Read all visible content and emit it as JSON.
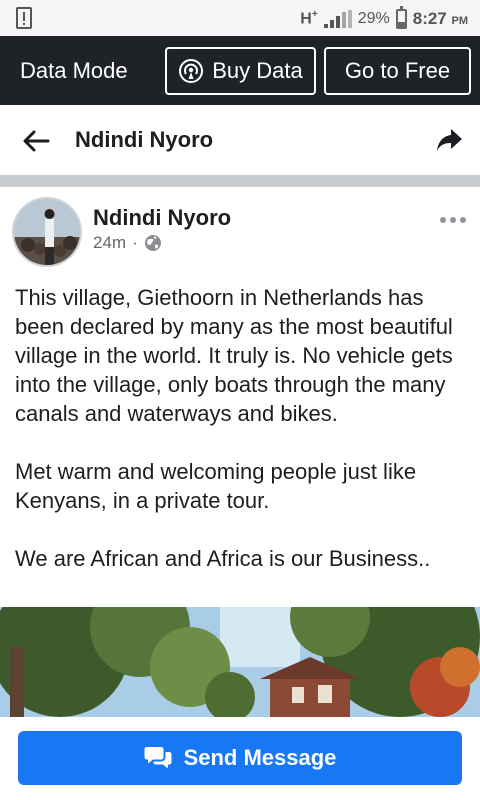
{
  "status_bar": {
    "network": "H",
    "network_sup": "+",
    "battery_pct": "29%",
    "battery_level": 0.29,
    "time": "8:27",
    "ampm": "PM"
  },
  "data_bar": {
    "mode_label": "Data Mode",
    "buy_label": "Buy Data",
    "free_label": "Go to Free"
  },
  "header": {
    "title": "Ndindi Nyoro"
  },
  "post": {
    "author": "Ndindi Nyoro",
    "time": "24m",
    "separator": "·",
    "paragraphs": [
      "This village, Giethoorn in Netherlands has been declared by many as the most beautiful village in the world. It truly is. No vehicle gets into the village, only boats through the many canals and waterways and bikes.",
      "Met warm and welcoming people just like Kenyans, in a private tour.",
      "We are African and Africa is our Business.."
    ]
  },
  "bottom": {
    "send_label": "Send Message"
  },
  "colors": {
    "primary": "#1877f2",
    "data_bar": "#1f2327",
    "divider": "#c9ccd1"
  }
}
